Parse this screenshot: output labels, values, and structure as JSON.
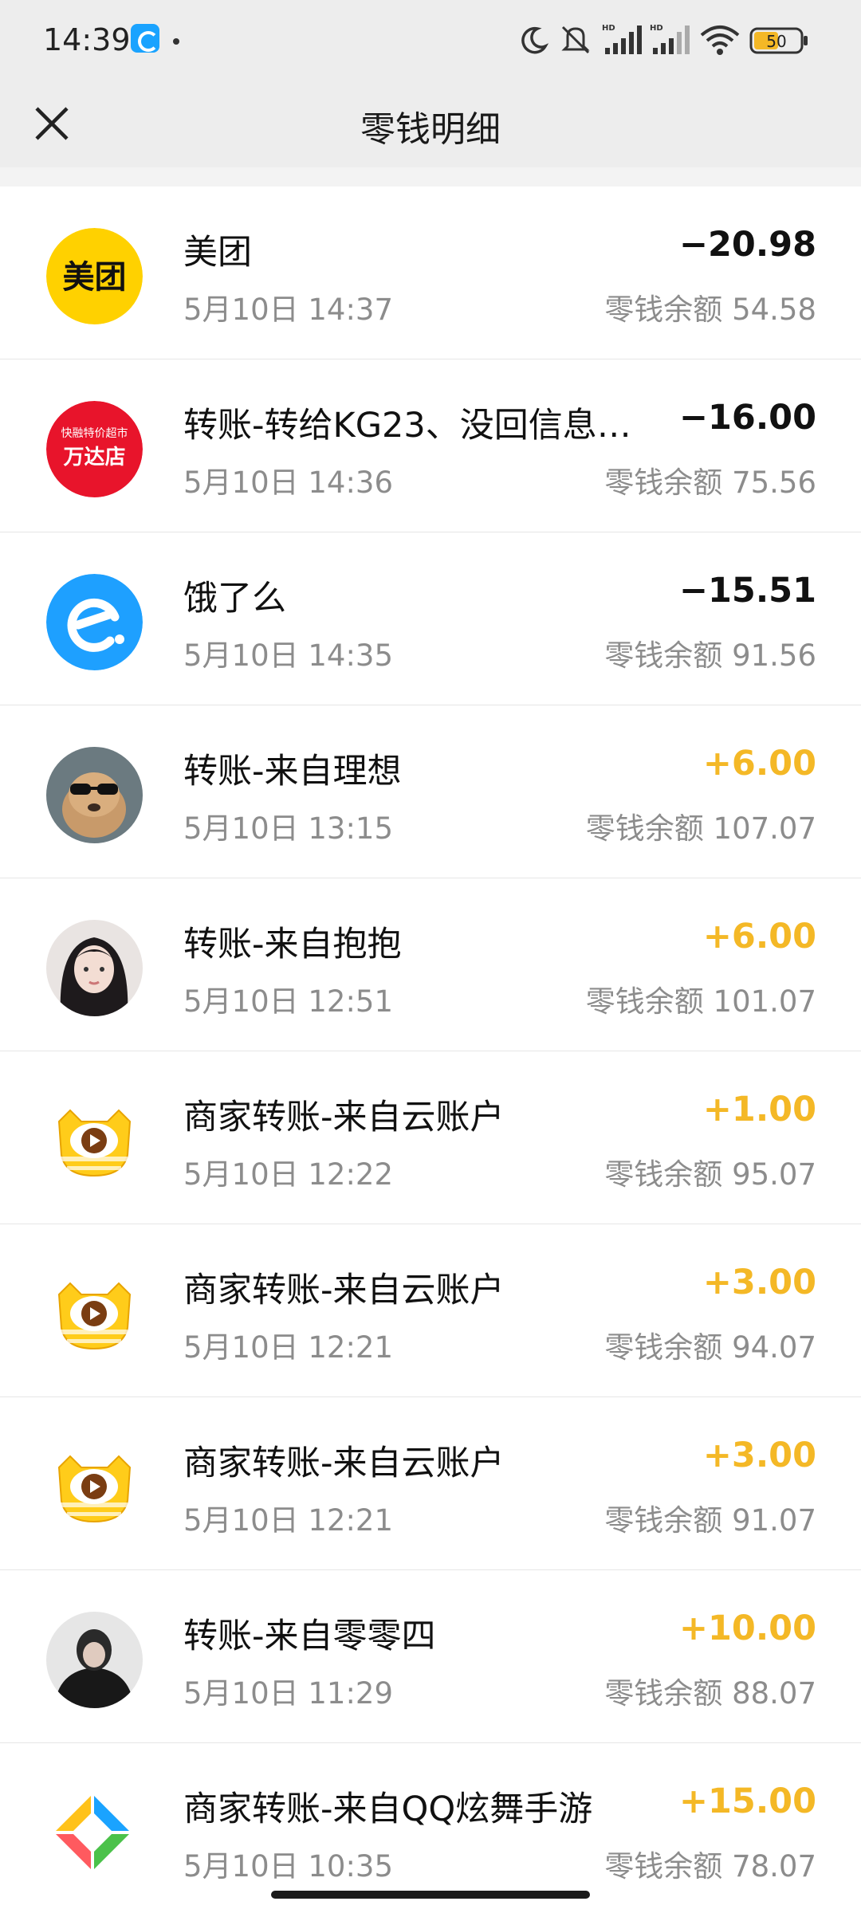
{
  "status_bar": {
    "time": "14:39",
    "battery": "50"
  },
  "header": {
    "title": "零钱明细"
  },
  "transactions": [
    {
      "icon": "meituan-logo",
      "avatar_text": "美团",
      "title": "美团",
      "time": "5月10日 14:37",
      "amount": "−20.98",
      "direction": "out",
      "balance": "零钱余额 54.58"
    },
    {
      "icon": "wanda-store-logo",
      "avatar_text_top": "快融特价超市",
      "avatar_text": "万达店",
      "title": "转账-转给KG23、没回信息…",
      "time": "5月10日 14:36",
      "amount": "−16.00",
      "direction": "out",
      "balance": "零钱余额 75.56"
    },
    {
      "icon": "eleme-logo",
      "title": "饿了么",
      "time": "5月10日 14:35",
      "amount": "−15.51",
      "direction": "out",
      "balance": "零钱余额 91.56"
    },
    {
      "icon": "dog-sunglasses-avatar",
      "title": "转账-来自理想",
      "time": "5月10日 13:15",
      "amount": "+6.00",
      "direction": "in",
      "balance": "零钱余额 107.07"
    },
    {
      "icon": "girl-portrait-avatar",
      "title": "转账-来自抱抱",
      "time": "5月10日 12:51",
      "amount": "+6.00",
      "direction": "in",
      "balance": "零钱余额 101.07"
    },
    {
      "icon": "yellow-cat-play-logo",
      "title": "商家转账-来自云账户",
      "time": "5月10日 12:22",
      "amount": "+1.00",
      "direction": "in",
      "balance": "零钱余额 95.07"
    },
    {
      "icon": "yellow-cat-play-logo",
      "title": "商家转账-来自云账户",
      "time": "5月10日 12:21",
      "amount": "+3.00",
      "direction": "in",
      "balance": "零钱余额 94.07"
    },
    {
      "icon": "yellow-cat-play-logo",
      "title": "商家转账-来自云账户",
      "time": "5月10日 12:21",
      "amount": "+3.00",
      "direction": "in",
      "balance": "零钱余额 91.07"
    },
    {
      "icon": "person-dark-avatar",
      "title": "转账-来自零零四",
      "time": "5月10日 11:29",
      "amount": "+10.00",
      "direction": "in",
      "balance": "零钱余额 88.07"
    },
    {
      "icon": "qq-dance-game-logo",
      "title": "商家转账-来自QQ炫舞手游",
      "time": "5月10日 10:35",
      "amount": "+15.00",
      "direction": "in",
      "balance": "零钱余额 78.07"
    }
  ],
  "colors": {
    "income": "#f4b826",
    "expense": "#111111",
    "meituan": "#ffd100",
    "eleme": "#1ea0ff",
    "wanda": "#e8142b"
  }
}
